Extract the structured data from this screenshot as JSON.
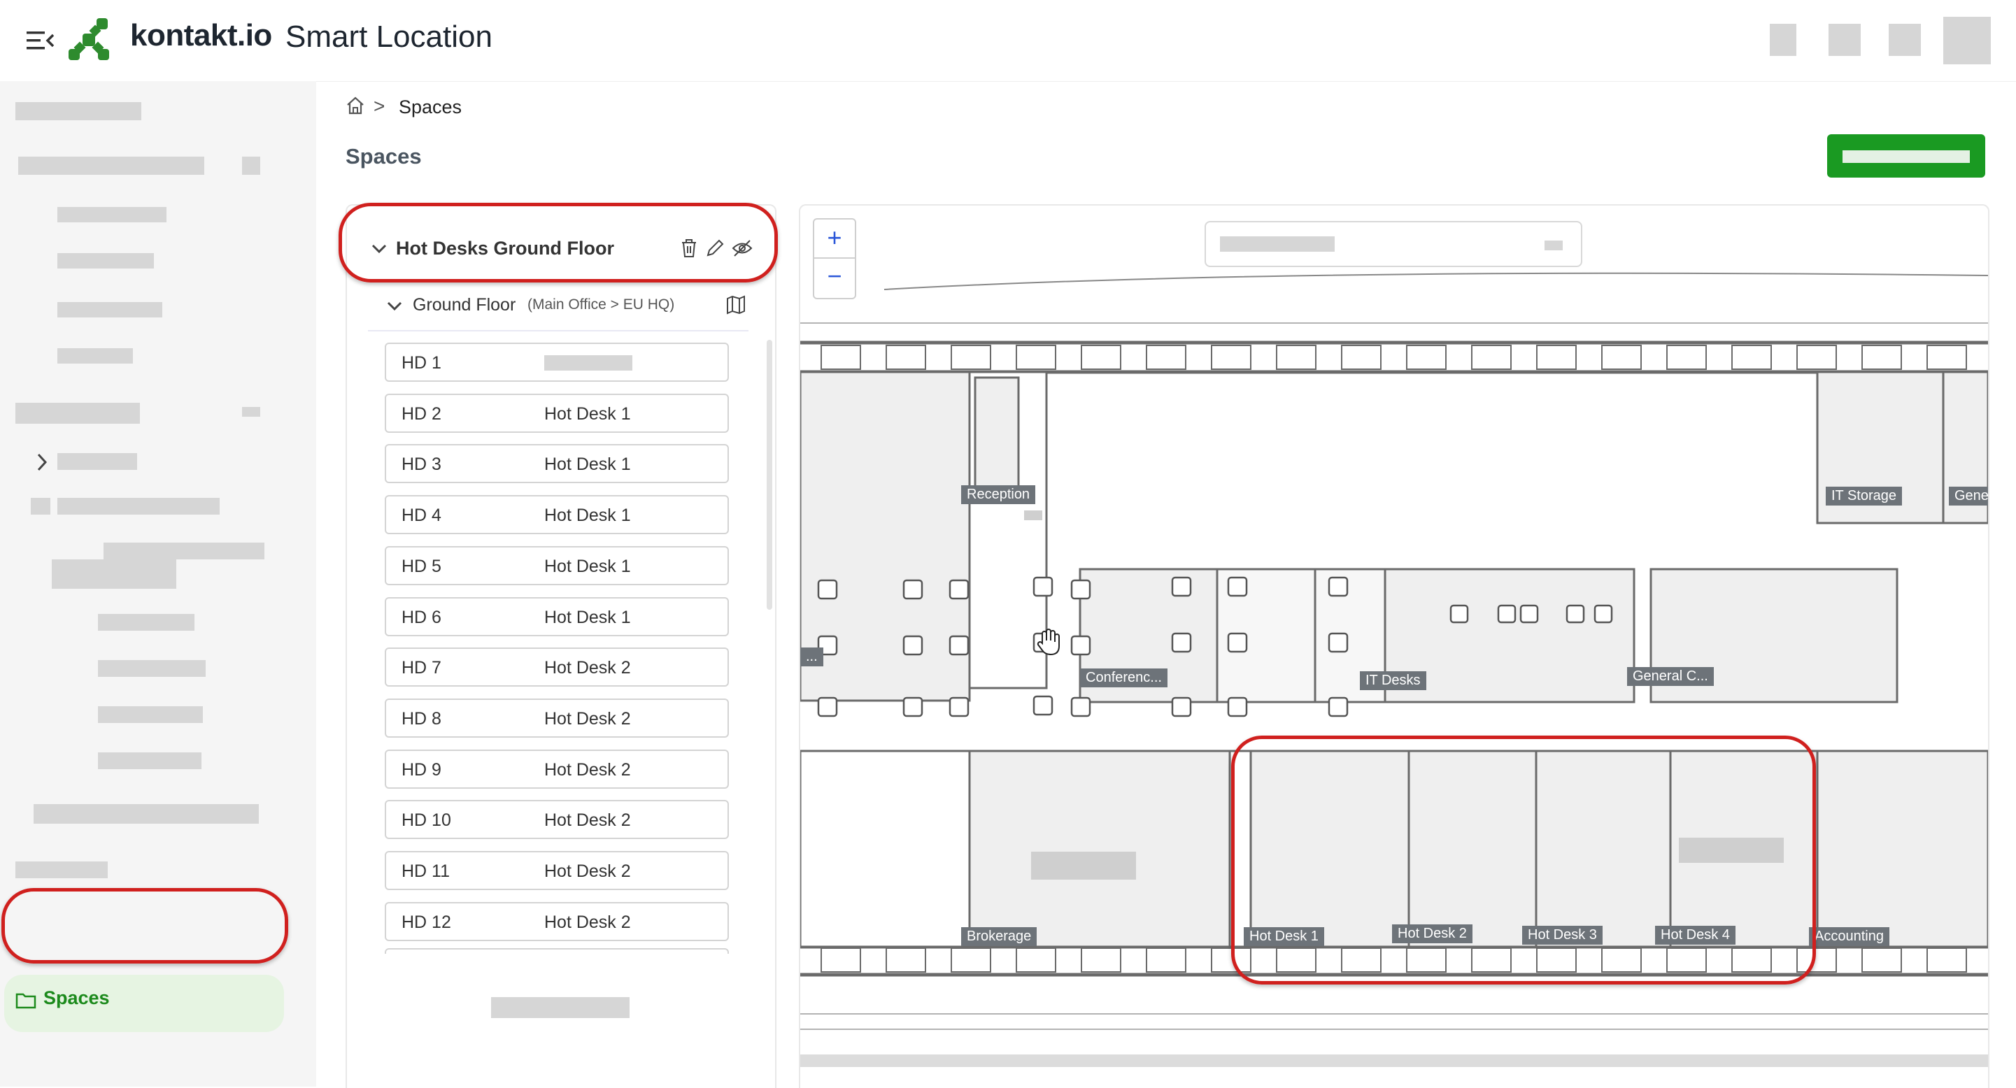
{
  "header": {
    "menu_icon": "menu-collapse-icon",
    "brand": "kontakt.io",
    "product": "Smart Location",
    "brand_color": "#2e8b2e"
  },
  "sidebar": {
    "active_item": {
      "label": "Spaces",
      "icon": "folder-icon"
    },
    "accent": "#1c8a1c"
  },
  "breadcrumb": {
    "home_icon": "home-icon",
    "separator": ">",
    "current": "Spaces"
  },
  "page": {
    "title": "Spaces",
    "primary_button_color": "#1a9a22"
  },
  "space_group": {
    "name": "Hot Desks Ground Floor",
    "actions": [
      "trash-icon",
      "pencil-icon",
      "eye-off-icon"
    ],
    "floor": {
      "name": "Ground Floor",
      "path": "(Main Office > EU HQ)",
      "map_icon": "map-icon"
    },
    "rows": [
      {
        "id": "HD 1",
        "desk": ""
      },
      {
        "id": "HD 2",
        "desk": "Hot Desk 1"
      },
      {
        "id": "HD 3",
        "desk": "Hot Desk 1"
      },
      {
        "id": "HD 4",
        "desk": "Hot Desk 1"
      },
      {
        "id": "HD 5",
        "desk": "Hot Desk 1"
      },
      {
        "id": "HD 6",
        "desk": "Hot Desk 1"
      },
      {
        "id": "HD 7",
        "desk": "Hot Desk 2"
      },
      {
        "id": "HD 8",
        "desk": "Hot Desk 2"
      },
      {
        "id": "HD 9",
        "desk": "Hot Desk 2"
      },
      {
        "id": "HD 10",
        "desk": "Hot Desk 2"
      },
      {
        "id": "HD 11",
        "desk": "Hot Desk 2"
      },
      {
        "id": "HD 12",
        "desk": "Hot Desk 2"
      }
    ]
  },
  "map": {
    "zoom_in": "+",
    "zoom_out": "−",
    "rooms": {
      "reception": "Reception",
      "it_storage": "IT Storage",
      "general_top": "Genera",
      "conference": "Conferenc...",
      "it_desks": "IT Desks",
      "general_c": "General C...",
      "brokerage": "Brokerage",
      "hot_desk_1": "Hot Desk 1",
      "hot_desk_2": "Hot Desk 2",
      "hot_desk_3": "Hot Desk 3",
      "hot_desk_4": "Hot Desk 4",
      "accounting": "Accounting",
      "left_ellipsis": "..."
    },
    "dims": [
      "160",
      "130",
      "100",
      "140",
      "160",
      "140",
      "160",
      "140",
      "160",
      "140",
      "160",
      "140",
      "160",
      "140",
      "160",
      "140",
      "386",
      "290",
      "370",
      "360",
      "105",
      "10",
      "35",
      "10",
      "233",
      "285",
      "300",
      "136",
      "120",
      "136",
      "658",
      "600",
      "120",
      "120",
      "120",
      "120",
      "220",
      "100",
      "94",
      "125",
      "15",
      "200",
      "335",
      "593",
      "356",
      "100",
      "200",
      "599",
      "1980",
      "320",
      "488",
      "493",
      "698",
      "160",
      "140",
      "160",
      "140",
      "160",
      "140",
      "160",
      "140",
      "160",
      "140",
      "160",
      "140",
      "244",
      "160",
      "129",
      "180",
      "81",
      "16"
    ]
  },
  "highlight_color": "#d0201e"
}
